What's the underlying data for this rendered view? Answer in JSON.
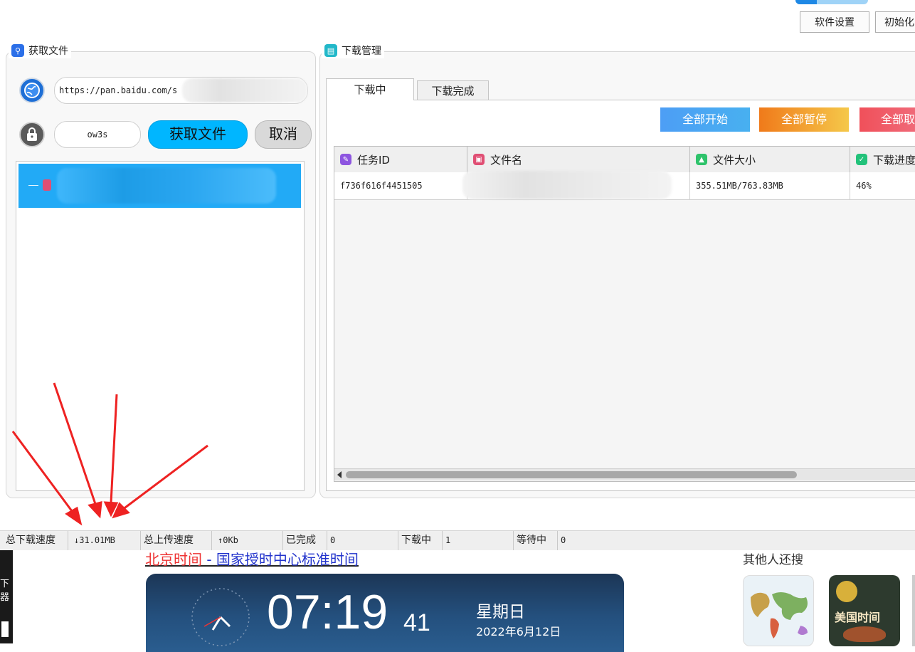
{
  "toolbar": {
    "settings_label": "软件设置",
    "init_label": "初始化"
  },
  "fetch_group": {
    "title": "获取文件",
    "url_value": "https://pan.baidu.com/s",
    "password_value": "ow3s",
    "fetch_button": "获取文件",
    "cancel_button": "取消"
  },
  "download_group": {
    "title": "下载管理",
    "tabs": [
      "下载中",
      "下载完成"
    ],
    "actions": {
      "start_all": "全部开始",
      "pause_all": "全部暂停",
      "cancel_all": "全部取"
    },
    "columns": [
      "任务ID",
      "文件名",
      "文件大小",
      "下载进度"
    ],
    "rows": [
      {
        "task_id": "f736f616f4451505",
        "file_name": "",
        "file_size": "355.51MB/763.83MB",
        "progress": "46%"
      }
    ]
  },
  "status_bar": {
    "dl_speed_label": "总下载速度",
    "dl_speed_value": "↓31.01MB",
    "ul_speed_label": "总上传速度",
    "ul_speed_value": "↑0Kb",
    "done_label": "已完成",
    "done_value": "0",
    "downloading_label": "下载中",
    "downloading_value": "1",
    "waiting_label": "等待中",
    "waiting_value": "0"
  },
  "browser": {
    "link_part1": "北京时间",
    "link_part2": " - 国家授时中心标准时间",
    "clock_time": "07:19",
    "clock_seconds": "41",
    "weekday": "星期日",
    "date": "2022年6月12日",
    "others_search": "其他人还搜",
    "thumb2_text": "美国时间",
    "side_fragment": "下器"
  },
  "colors": {
    "accent_blue": "#00b6ff",
    "selected_row": "#22aaf6",
    "start_btn": "#4d9ef5",
    "pause_btn": "#f08a1e",
    "cancel_btn": "#f0505a",
    "arrow_red": "#ee2222"
  }
}
